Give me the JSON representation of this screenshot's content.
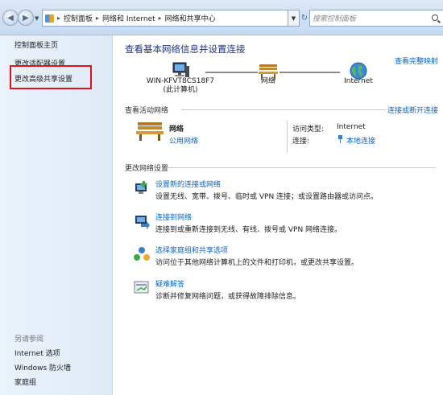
{
  "address": {
    "breadcrumbs": [
      "控制面板",
      "网络和 Internet",
      "网络和共享中心"
    ],
    "separator": "▸",
    "dropdown_arrow": "▼",
    "back_icon": "back-arrow-icon",
    "forward_icon": "forward-arrow-icon"
  },
  "search": {
    "placeholder": "搜索控制面板"
  },
  "sidebar": {
    "home": "控制面板主页",
    "items": [
      {
        "label": "更改适配器设置"
      },
      {
        "label": "更改高级共享设置"
      }
    ],
    "see_also_title": "另请参阅",
    "see_also": [
      {
        "label": "Internet 选项"
      },
      {
        "label": "Windows 防火墙"
      },
      {
        "label": "家庭组"
      }
    ],
    "highlight_color": "#e0111b"
  },
  "main": {
    "title": "查看基本网络信息并设置连接",
    "full_map_link": "查看完整映射",
    "map": {
      "computer_name": "WIN-KFVT8CS18F7",
      "computer_sub": "(此计算机)",
      "network_label": "网络",
      "internet_label": "Internet"
    },
    "active_section": {
      "title": "查看活动网络",
      "connect_link": "连接或断开连接",
      "network_name": "网络",
      "network_type": "公用网络",
      "access_type_key": "访问类型:",
      "access_type_value": "Internet",
      "connection_key": "连接:",
      "connection_value": "本地连接"
    },
    "change_section": {
      "title": "更改网络设置",
      "tasks": [
        {
          "link": "设置新的连接或网络",
          "desc": "设置无线、宽带、拨号、临时或 VPN 连接；或设置路由器或访问点。",
          "icon": "new-connection-icon"
        },
        {
          "link": "连接到网络",
          "desc": "连接到或重新连接到无线、有线、拨号或 VPN 网络连接。",
          "icon": "connect-network-icon"
        },
        {
          "link": "选择家庭组和共享选项",
          "desc": "访问位于其他网络计算机上的文件和打印机，或更改共享设置。",
          "icon": "homegroup-icon"
        },
        {
          "link": "疑难解答",
          "desc": "诊断并修复网络问题，或获得故障排除信息。",
          "icon": "troubleshoot-icon"
        }
      ]
    }
  },
  "colors": {
    "link": "#0a66c2",
    "title": "#1e3287",
    "sidebar_bg": "#e3edf9",
    "highlight": "#e0111b"
  }
}
